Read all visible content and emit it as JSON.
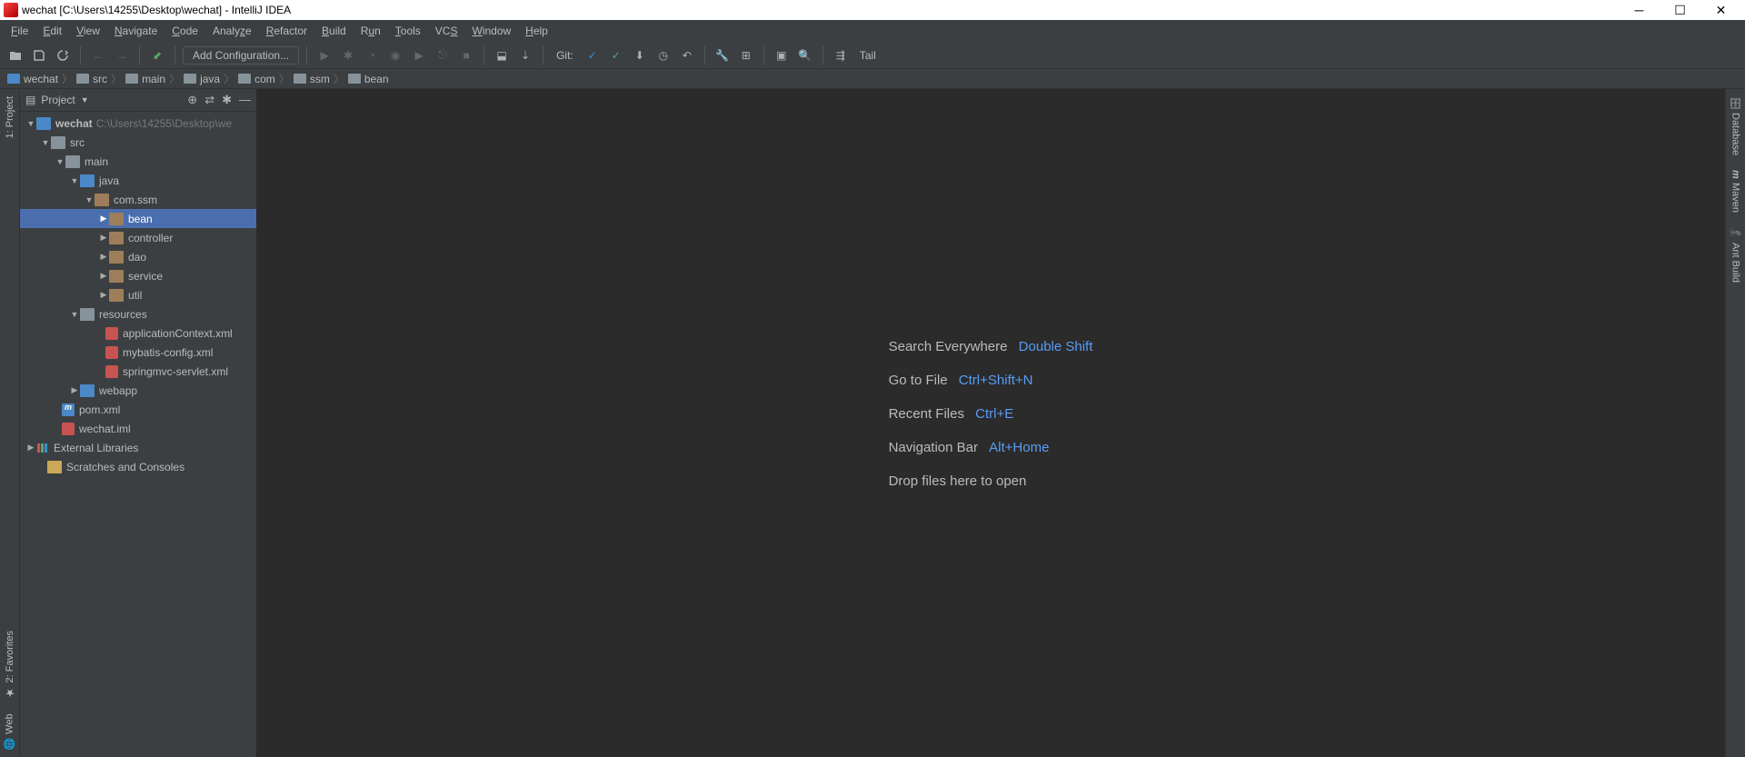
{
  "titlebar": {
    "text": "wechat [C:\\Users\\14255\\Desktop\\wechat] - IntelliJ IDEA"
  },
  "menu": [
    "File",
    "Edit",
    "View",
    "Navigate",
    "Code",
    "Analyze",
    "Refactor",
    "Build",
    "Run",
    "Tools",
    "VCS",
    "Window",
    "Help"
  ],
  "toolbar": {
    "add_config": "Add Configuration...",
    "git_label": "Git:",
    "tail_label": "Tail"
  },
  "breadcrumbs": [
    "wechat",
    "src",
    "main",
    "java",
    "com",
    "ssm",
    "bean"
  ],
  "sidebar": {
    "title": "Project"
  },
  "tree": {
    "root": {
      "name": "wechat",
      "path": "C:\\Users\\14255\\Desktop\\we"
    },
    "src": "src",
    "main": "main",
    "java": "java",
    "comssm": "com.ssm",
    "bean": "bean",
    "controller": "controller",
    "dao": "dao",
    "service": "service",
    "util": "util",
    "resources": "resources",
    "appctx": "applicationContext.xml",
    "mybatis": "mybatis-config.xml",
    "springmvc": "springmvc-servlet.xml",
    "webapp": "webapp",
    "pom": "pom.xml",
    "iml": "wechat.iml",
    "extlib": "External Libraries",
    "scratches": "Scratches and Consoles"
  },
  "left_rail": {
    "project": "1: Project",
    "favorites": "2: Favorites",
    "web": "Web"
  },
  "right_rail": {
    "database": "Database",
    "maven": "Maven",
    "ant": "Ant Build"
  },
  "welcome": {
    "search": {
      "label": "Search Everywhere",
      "key": "Double Shift"
    },
    "goto": {
      "label": "Go to File",
      "key": "Ctrl+Shift+N"
    },
    "recent": {
      "label": "Recent Files",
      "key": "Ctrl+E"
    },
    "nav": {
      "label": "Navigation Bar",
      "key": "Alt+Home"
    },
    "drop": "Drop files here to open"
  }
}
